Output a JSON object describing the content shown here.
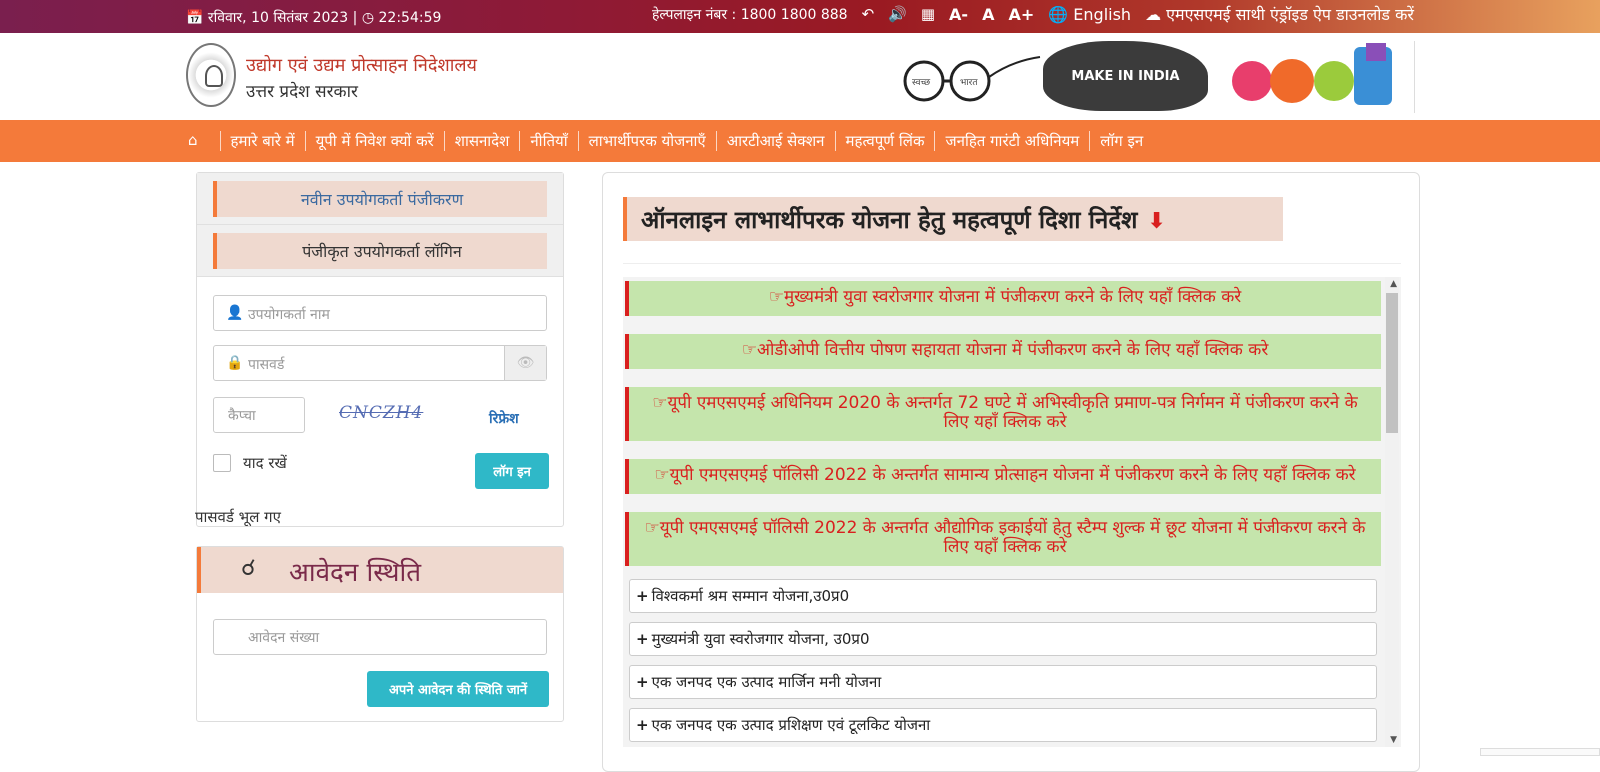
{
  "topbar": {
    "date": "रविवार, 10 सितंबर 2023 |",
    "time": "22:54:59",
    "helpline": "हेल्पलाइन नंबर : 1800 1800 888",
    "font_small": "A-",
    "font_normal": "A",
    "font_large": "A+",
    "language": "English",
    "app_download": "एमएसएमई साथी एंड्रॉइड ऐप डाउनलोड करें"
  },
  "header": {
    "org_name": "उद्योग एवं उद्यम प्रोत्साहन निदेशालय",
    "gov_name": "उत्तर प्रदेश सरकार",
    "swachh_text_left": "स्वच्छ",
    "swachh_text_right": "भारत",
    "make_in_india": "MAKE IN INDIA"
  },
  "nav": {
    "items": [
      "हमारे बारे में",
      "यूपी में निवेश क्यों करें",
      "शासनादेश",
      "नीतियाँ",
      "लाभार्थीपरक योजनाएँ",
      "आरटीआई सेक्शन",
      "महत्वपूर्ण लिंक",
      "जनहित गारंटी अधिनियम",
      "लॉग इन"
    ]
  },
  "login": {
    "new_registration": "नवीन उपयोगकर्ता पंजीकरण",
    "registered_login": "पंजीकृत उपयोगकर्ता लॉगिन",
    "username_placeholder": "उपयोगकर्ता नाम",
    "password_placeholder": "पासवर्ड",
    "captcha_placeholder": "कैप्चा",
    "captcha_text": "CNCZH4",
    "refresh": "रिफ्रेश",
    "remember": "याद रखें",
    "login_button": "लॉग इन",
    "forgot": "पासवर्ड भूल गए"
  },
  "status": {
    "title": "आवेदन स्थिति",
    "app_number_placeholder": "आवेदन संख्या",
    "check_button": "अपने आवेदन की स्थिति जानें"
  },
  "main": {
    "title": "ऑनलाइन लाभार्थीपरक योजना हेतु महत्वपूर्ण दिशा निर्देश",
    "links": [
      "☞मुख्यमंत्री युवा स्वरोजगार योजना में पंजीकरण करने के लिए यहाँ क्लिक करे",
      "☞ओडीओपी वित्तीय पोषण सहायता योजना में पंजीकरण करने के लिए यहाँ क्लिक करे",
      "☞यूपी एमएसएमई अधिनियम 2020 के अन्तर्गत 72 घण्टे में अभिस्वीकृति प्रमाण-पत्र निर्गमन में पंजीकरण करने के लिए यहाँ क्लिक करे",
      "☞यूपी एमएसएमई पॉलिसी 2022 के अन्तर्गत सामान्य प्रोत्साहन योजना में पंजीकरण करने के लिए यहाँ क्लिक करे",
      "☞यूपी एमएसएमई पॉलिसी 2022 के अन्तर्गत औद्योगिक इकाईयों हेतु स्टैम्प शुल्क में छूट योजना में पंजीकरण करने के लिए यहाँ क्लिक करे"
    ],
    "schemes": [
      "विश्वकर्मा श्रम सम्मान योजना,उ0प्र0",
      "मुख्यमंत्री युवा स्वरोजगार योजना, उ0प्र0",
      "एक जनपद एक उत्पाद मार्जिन मनी योजना",
      "एक जनपद एक उत्पाद प्रशिक्षण एवं टूलकिट योजना"
    ]
  }
}
